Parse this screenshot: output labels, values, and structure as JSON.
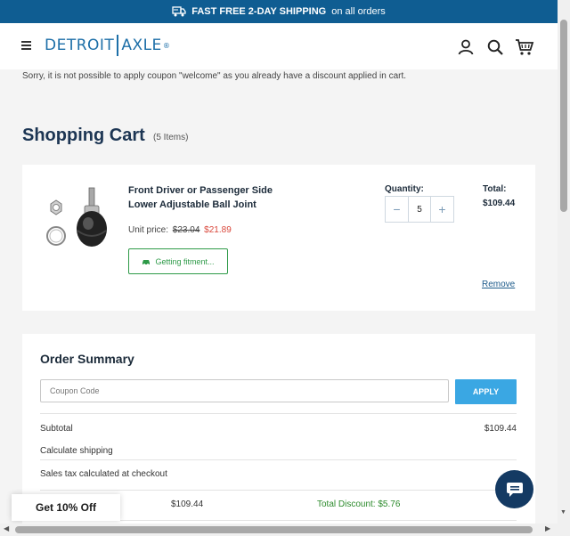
{
  "promo": {
    "bold_text": "FAST FREE 2-DAY SHIPPING",
    "suffix": "on all orders",
    "icon": "delivery-truck-icon"
  },
  "header": {
    "logo_left": "DETROIT",
    "logo_right": "AXLE",
    "logo_tm": "®",
    "icons": [
      "menu-icon",
      "account-icon",
      "search-icon",
      "cart-icon"
    ]
  },
  "notice": {
    "coupon_message": "Sorry, it is not possible to apply coupon \"welcome\" as you already have a discount applied in cart."
  },
  "cart": {
    "title": "Shopping Cart",
    "item_count": "(5 Items)",
    "item": {
      "name": "Front Driver or Passenger Side Lower Adjustable Ball Joint",
      "unit_price_label": "Unit price:",
      "old_price": "$23.04",
      "new_price": "$21.89",
      "fitment_label": "Getting fitment...",
      "quantity_label": "Quantity:",
      "quantity": "5",
      "total_label": "Total:",
      "total_value": "$109.44",
      "remove_label": "Remove"
    }
  },
  "summary": {
    "title": "Order Summary",
    "coupon_placeholder": "Coupon Code",
    "apply_label": "APPLY",
    "subtotal_label": "Subtotal",
    "subtotal_value": "$109.44",
    "shipping_label": "Calculate shipping",
    "tax_label": "Sales tax calculated at checkout",
    "total_value": "$109.44",
    "discount_text": "Total Discount: $5.76"
  },
  "promo_popup": {
    "label": "Get 10% Off"
  },
  "colors": {
    "promo_bar": "#0f5d92",
    "title": "#1c3553",
    "apply": "#3aa7e3",
    "sale_price": "#d9463a",
    "fitment": "#2e9a48",
    "chat": "#143a63"
  }
}
